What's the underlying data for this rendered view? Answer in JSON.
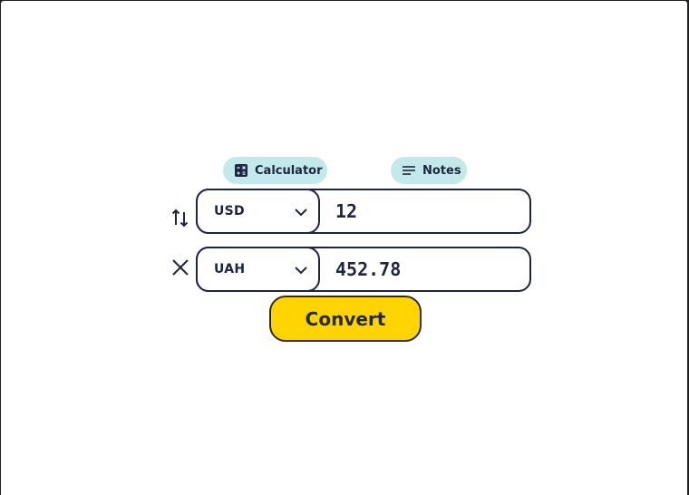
{
  "tabs": {
    "calculator_label": "Calculator",
    "notes_label": "Notes"
  },
  "from": {
    "currency": "USD",
    "amount": "12"
  },
  "to": {
    "currency": "UAH",
    "amount": "452.78"
  },
  "actions": {
    "convert_label": "Convert"
  },
  "icons": {
    "calculator": "calculator-icon",
    "notes": "notes-icon",
    "swap": "swap-icon",
    "clear": "close-icon",
    "dropdown": "chevron-down-icon"
  },
  "colors": {
    "accent": "#ffd400",
    "chip_bg": "#c3e9ec",
    "text": "#1f2440"
  }
}
